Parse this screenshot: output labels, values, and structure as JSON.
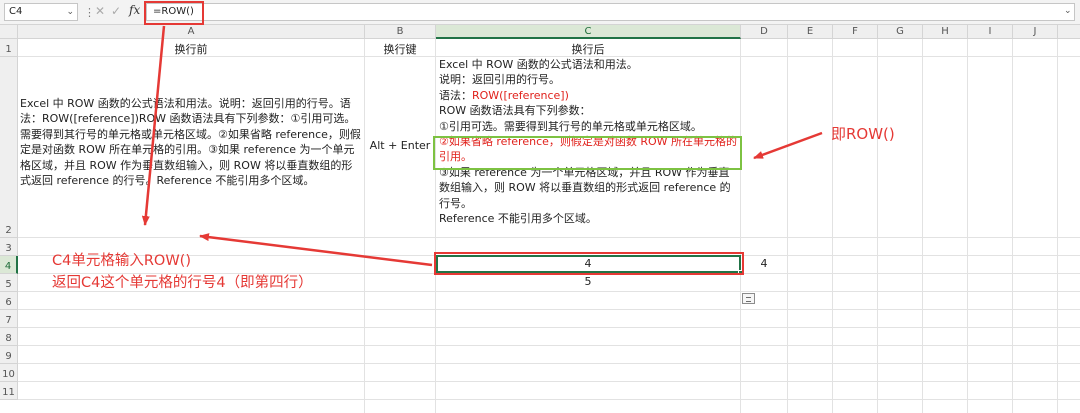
{
  "formula_bar": {
    "name_box": "C4",
    "formula": "=ROW()",
    "fx_label": "fx",
    "icons": [
      "chevron-down-icon",
      "close-icon",
      "check-icon",
      "fx-icon",
      "chevron-down-icon"
    ]
  },
  "columns": [
    "A",
    "B",
    "C",
    "D",
    "E",
    "F",
    "G",
    "H",
    "I",
    "J"
  ],
  "rows": [
    "1",
    "2",
    "3",
    "4",
    "5",
    "6",
    "7",
    "8",
    "9",
    "10",
    "11"
  ],
  "cells": {
    "A1": "换行前",
    "B1": "换行键",
    "C1": "换行后",
    "A2": "Excel 中 ROW 函数的公式语法和用法。说明：返回引用的行号。语法：ROW([reference])ROW 函数语法具有下列参数：①引用可选。需要得到其行号的单元格或单元格区域。②如果省略 reference，则假定是对函数 ROW 所在单元格的引用。③如果 reference 为一个单元格区域，并且 ROW 作为垂直数组输入，则 ROW 将以垂直数组的形式返回 reference 的行号。Reference 不能引用多个区域。",
    "B2": "Alt + Enter",
    "C2": {
      "l1": "Excel 中 ROW 函数的公式语法和用法。",
      "l2": "说明：返回引用的行号。",
      "l3_prefix": "语法：",
      "l3_red": "ROW([reference])",
      "l4": "ROW 函数语法具有下列参数：",
      "l5": "①引用可选。需要得到其行号的单元格或单元格区域。",
      "l6_red": "②如果省略 reference，则假定是对函数 ROW 所在单元格的引用。",
      "l7": "③如果 reference 为一个单元格区域，并且 ROW 作为垂直数组输入，则 ROW 将以垂直数组的形式返回 reference 的行号。",
      "l8": "Reference 不能引用多个区域。"
    },
    "C4": "4",
    "D4": "4",
    "C5": "5"
  },
  "annotations": {
    "left_line1": "C4单元格输入ROW()",
    "left_line2": "返回C4这个单元格的行号4（即第四行）",
    "right": "即ROW()"
  },
  "colors": {
    "annotation_red": "#e53935",
    "highlight_green": "#7dc242",
    "excel_green": "#217346",
    "text_red": "#e0211b"
  }
}
